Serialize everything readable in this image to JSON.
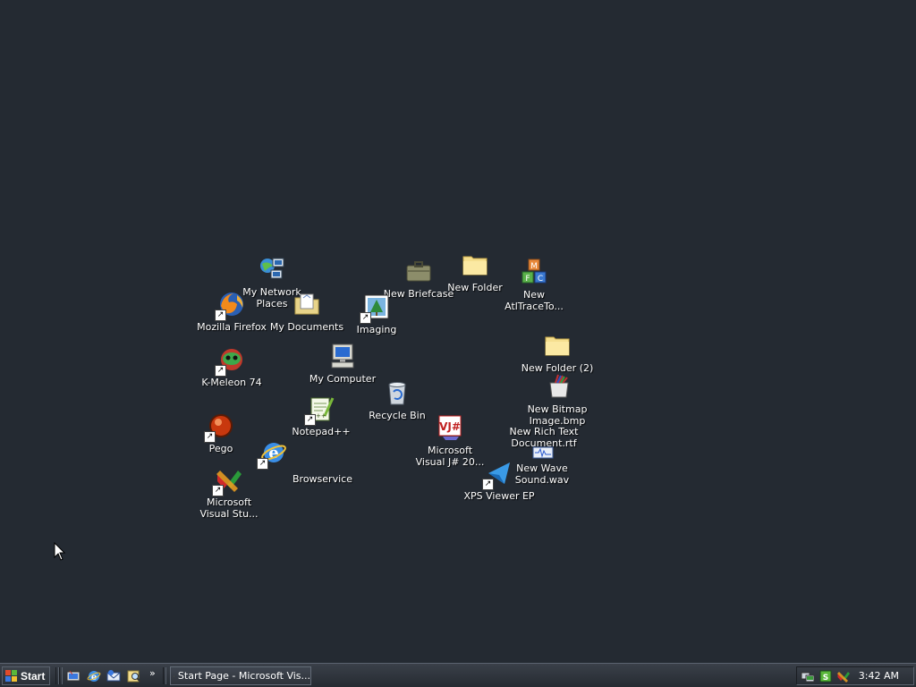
{
  "desktop": {
    "background_color": "#242a32",
    "icons": [
      {
        "name": "my-network-places",
        "label": "My Network\nPlaces",
        "icon": "network-icon",
        "shortcut": false
      },
      {
        "name": "mozilla-firefox",
        "label": "Mozilla Firefox",
        "icon": "firefox-icon",
        "shortcut": true
      },
      {
        "name": "my-documents",
        "label": "My Documents",
        "icon": "documents-folder-icon",
        "shortcut": false
      },
      {
        "name": "new-briefcase",
        "label": "New Briefcase",
        "icon": "briefcase-icon",
        "shortcut": false
      },
      {
        "name": "new-folder",
        "label": "New Folder",
        "icon": "folder-icon",
        "shortcut": false
      },
      {
        "name": "new-atltraceto",
        "label": "New\nAtlTraceTo...",
        "icon": "blocks-icon",
        "shortcut": false
      },
      {
        "name": "imaging",
        "label": "Imaging",
        "icon": "imaging-icon",
        "shortcut": true
      },
      {
        "name": "k-meleon",
        "label": "K-Meleon 74",
        "icon": "k-meleon-icon",
        "shortcut": true
      },
      {
        "name": "my-computer",
        "label": "My Computer",
        "icon": "computer-icon",
        "shortcut": false
      },
      {
        "name": "new-folder-2",
        "label": "New Folder (2)",
        "icon": "folder-icon",
        "shortcut": false
      },
      {
        "name": "new-bitmap",
        "label": "New Bitmap\nImage.bmp",
        "icon": "bitmap-icon",
        "shortcut": false
      },
      {
        "name": "recycle-bin",
        "label": "Recycle Bin",
        "icon": "recycle-bin-icon",
        "shortcut": false
      },
      {
        "name": "pego",
        "label": "Pego",
        "icon": "pego-icon",
        "shortcut": true
      },
      {
        "name": "notepad-plus-plus",
        "label": "Notepad++",
        "icon": "notepad-icon",
        "shortcut": true
      },
      {
        "name": "new-rich-text",
        "label": "New Rich Text\nDocument.rtf",
        "icon": "rtf-icon",
        "shortcut": false
      },
      {
        "name": "microsoft-visual-j",
        "label": "Microsoft\nVisual J# 20...",
        "icon": "visual-j-icon",
        "shortcut": false
      },
      {
        "name": "browservice",
        "label": "Browservice",
        "icon": "ie-icon",
        "shortcut": true
      },
      {
        "name": "new-wave-sound",
        "label": "New Wave\nSound.wav",
        "icon": "wave-icon",
        "shortcut": false
      },
      {
        "name": "xps-viewer",
        "label": "XPS Viewer EP",
        "icon": "xps-icon",
        "shortcut": true
      },
      {
        "name": "microsoft-visual-studio",
        "label": "Microsoft\nVisual Stu...",
        "icon": "visual-studio-icon",
        "shortcut": true
      }
    ]
  },
  "taskbar": {
    "start_label": "Start",
    "quick_launch": [
      "show-desktop-icon",
      "ie-icon",
      "outlook-icon",
      "search-icon"
    ],
    "more_label": "»",
    "task_button_label": "Start Page - Microsoft Vis...",
    "tray_icons": [
      "network-tray-icon",
      "security-tray-icon",
      "visual-studio-tray-icon"
    ],
    "clock": "3:42 AM"
  }
}
